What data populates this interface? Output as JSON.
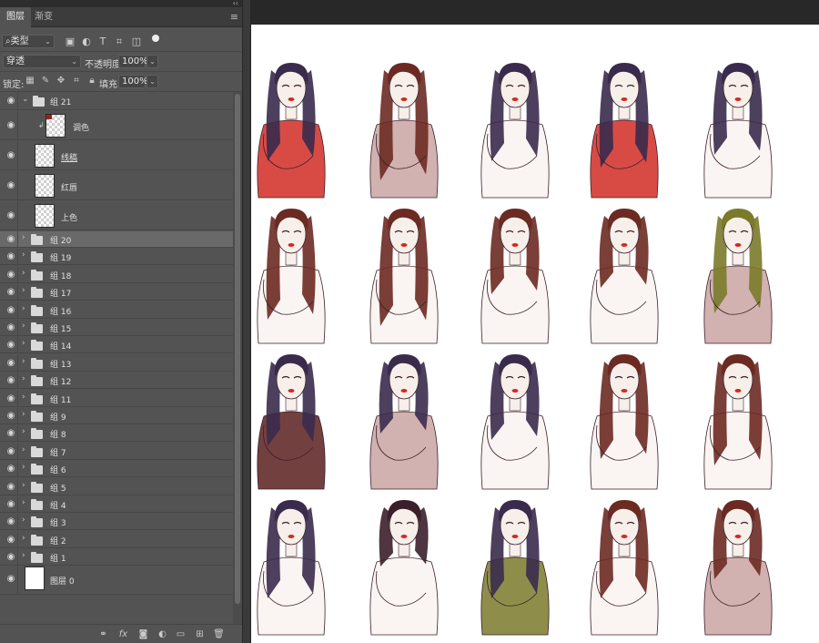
{
  "panel": {
    "collapse_icon": "double-chevron-left-icon",
    "tabs": [
      {
        "label": "图层",
        "active": true
      },
      {
        "label": "渐变",
        "active": false
      }
    ],
    "menu_icon": "panel-menu-icon"
  },
  "filter": {
    "kind_label": "类型",
    "icons": [
      "image-filter-icon",
      "adjustment-filter-icon",
      "text-filter-icon",
      "shape-filter-icon",
      "smart-object-filter-icon"
    ]
  },
  "blend": {
    "mode": "穿透",
    "opacity_label": "不透明度:",
    "opacity_value": "100%"
  },
  "lock": {
    "label": "锁定:",
    "fill_label": "填充:",
    "fill_value": "100%"
  },
  "layers": {
    "group21": {
      "name": "组 21",
      "expanded": true
    },
    "children": [
      {
        "name": "调色",
        "clipped": true
      },
      {
        "name": "线稿",
        "clipped": false
      },
      {
        "name": "红唇",
        "clipped": false
      },
      {
        "name": "上色",
        "clipped": false
      }
    ],
    "groups": [
      "组 20",
      "组 19",
      "组 18",
      "组 17",
      "组 16",
      "组 15",
      "组 14",
      "组 13",
      "组 12",
      "组 11",
      "组 9",
      "组 8",
      "组 7",
      "组 6",
      "组 5",
      "组 4",
      "组 3",
      "组 2",
      "组 1"
    ],
    "selected": "组 20",
    "background": "图层 0"
  },
  "bottom_icons": [
    "link-layers-icon",
    "fx-icon",
    "add-mask-icon",
    "new-adjustment-icon",
    "new-group-icon",
    "new-layer-icon",
    "delete-layer-icon"
  ],
  "canvas": {
    "background": "#ffffff",
    "figure_count": 20,
    "palette": {
      "ink": "#3b1f2a",
      "hair_dark": "#3a2b4d",
      "hair_brown": "#6b2a22",
      "red": "#d12b25",
      "olive": "#7a7a2a",
      "skin": "#f7efe9",
      "dress_pink": "#c9a5a2",
      "shirt_maroon": "#5a1e1e"
    }
  }
}
